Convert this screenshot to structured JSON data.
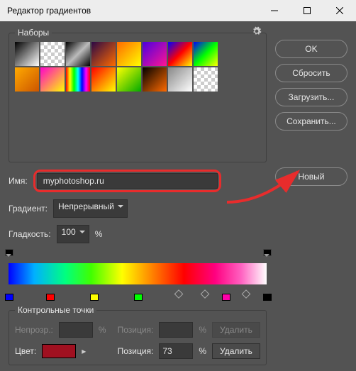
{
  "title": "Редактор градиентов",
  "presets": {
    "label": "Наборы"
  },
  "buttons": {
    "ok": "OK",
    "reset": "Сбросить",
    "load": "Загрузить...",
    "save": "Сохранить...",
    "new": "Новый",
    "delete": "Удалить"
  },
  "name": {
    "label": "Имя:",
    "value": "myphotoshop.ru"
  },
  "gradient": {
    "type_label": "Градиент:",
    "type_value": "Непрерывный",
    "smooth_label": "Гладкость:",
    "smooth_value": "100",
    "percent": "%"
  },
  "stops": {
    "label": "Контрольные точки",
    "opacity_label": "Непрозр.:",
    "opacity_value": "",
    "position_label": "Позиция:",
    "position_value": "73",
    "color_label": "Цвет:",
    "color_value": "#a01020"
  },
  "swatches": [
    "linear-gradient(135deg,#000,#fff)",
    "repeating-conic-gradient(#fff 0 25%,#ccc 0 50%) 0 0/10px 10px",
    "linear-gradient(135deg,#000,#bbb,#000)",
    "linear-gradient(135deg,#2a0845,#ff6a00)",
    "linear-gradient(135deg,#ff6a00,#ffff00)",
    "linear-gradient(135deg,#4a00e0,#ff1493)",
    "linear-gradient(135deg,#0000ff,#ff0000,#ffff00)",
    "linear-gradient(135deg,#0000ff,#00ff00,#ffff00)",
    "linear-gradient(135deg,#ffaa00,#cc5500)",
    "linear-gradient(135deg,#ff00cc,#ffff00)",
    "linear-gradient(90deg,#ff0000,#ffff00,#00ff00,#00ffff,#0000ff,#ff00ff,#ff0000)",
    "linear-gradient(135deg,#ff0000,#ffff00)",
    "linear-gradient(135deg,#ffff00,#00aa00)",
    "linear-gradient(135deg,#000,#ff6a00)",
    "linear-gradient(135deg,#888,#fff)",
    "repeating-conic-gradient(#fff 0 25%,#ccc 0 50%) 0 0/10px 10px"
  ],
  "color_stops": [
    {
      "pos": 0,
      "c": "#0000ff"
    },
    {
      "pos": 16,
      "c": "#ff0000"
    },
    {
      "pos": 33,
      "c": "#ffff00"
    },
    {
      "pos": 50,
      "c": "#00ff00"
    },
    {
      "pos": 84,
      "c": "#ff00aa"
    },
    {
      "pos": 100,
      "c": "#000000"
    }
  ],
  "mid_points": [
    66,
    76,
    92
  ],
  "opacity_stops": [
    0,
    100
  ]
}
